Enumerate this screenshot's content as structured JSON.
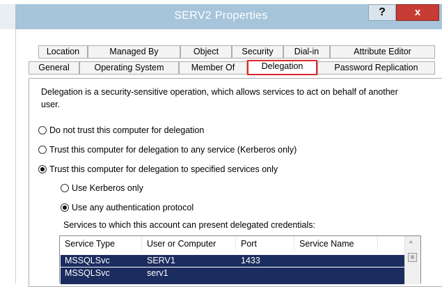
{
  "window": {
    "title": "SERV2 Properties",
    "help_label": "?",
    "close_label": "x"
  },
  "tabs_row1": [
    {
      "label": "Location"
    },
    {
      "label": "Managed By"
    },
    {
      "label": "Object"
    },
    {
      "label": "Security"
    },
    {
      "label": "Dial-in"
    },
    {
      "label": "Attribute Editor"
    }
  ],
  "tabs_row2": [
    {
      "label": "General"
    },
    {
      "label": "Operating System"
    },
    {
      "label": "Member Of"
    },
    {
      "label": "Delegation"
    },
    {
      "label": "Password Replication"
    }
  ],
  "active_tab": "Delegation",
  "delegation": {
    "description": "Delegation is a security-sensitive operation, which allows services to act on behalf of another user.",
    "options": [
      {
        "label": "Do not trust this computer for delegation",
        "checked": false
      },
      {
        "label": "Trust this computer for delegation to any service (Kerberos only)",
        "checked": false
      },
      {
        "label": "Trust this computer for delegation to specified services only",
        "checked": true
      }
    ],
    "sub_options": [
      {
        "label": "Use Kerberos only",
        "checked": false
      },
      {
        "label": "Use any authentication protocol",
        "checked": true
      }
    ],
    "services_label": "Services to which this account can present delegated credentials:",
    "columns": [
      "Service Type",
      "User or Computer",
      "Port",
      "Service Name"
    ],
    "rows": [
      {
        "service_type": "MSSQLSvc",
        "user_or_computer": "SERV1",
        "port": "1433",
        "service_name": ""
      },
      {
        "service_type": "MSSQLSvc",
        "user_or_computer": "serv1",
        "port": "",
        "service_name": ""
      }
    ]
  },
  "colors": {
    "titlebar": "#a6c4da",
    "close": "#c73c34",
    "selection": "#1b2c5e",
    "highlight_border": "#e0262a"
  }
}
